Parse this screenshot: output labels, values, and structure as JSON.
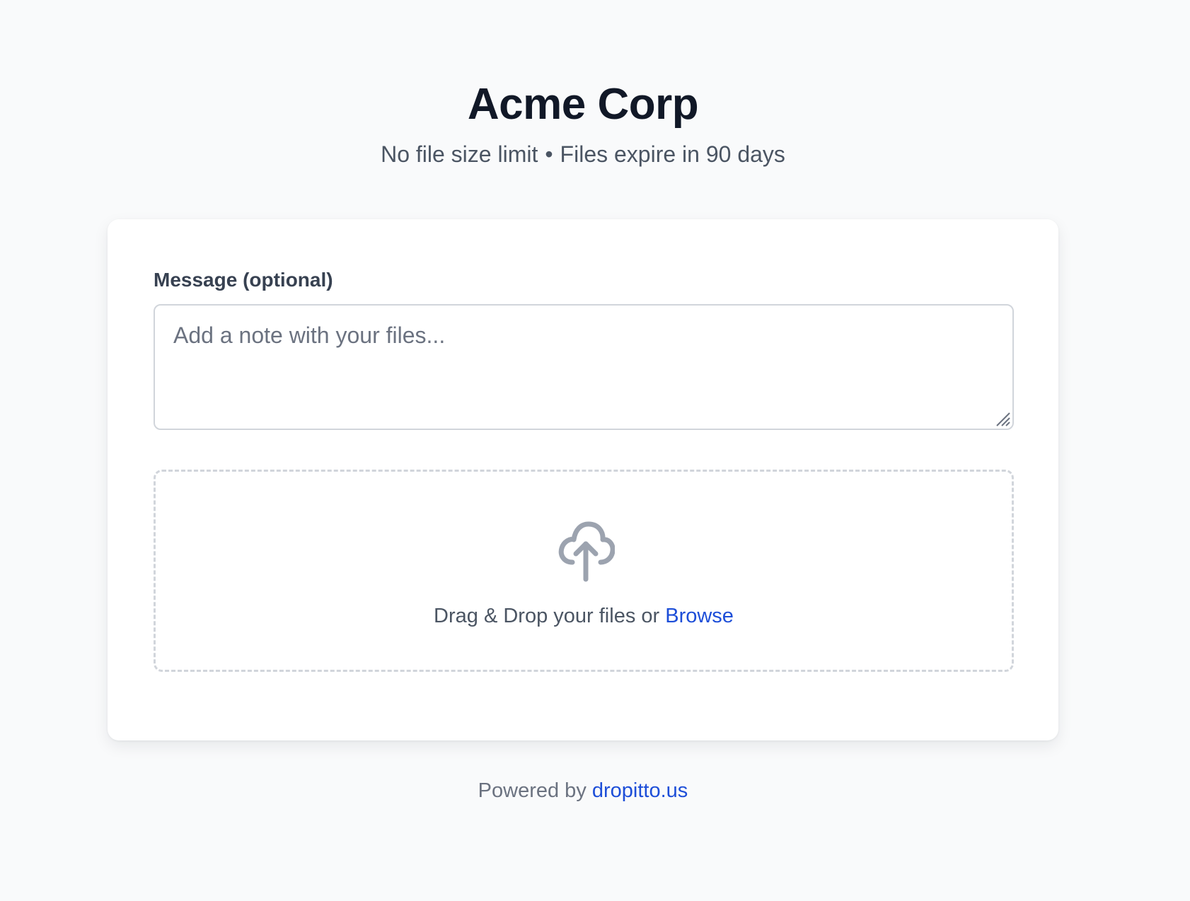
{
  "header": {
    "title": "Acme Corp",
    "size_limit": "No file size limit",
    "separator": "•",
    "expiry": "Files expire in 90 days"
  },
  "form": {
    "message_label": "Message (optional)",
    "message_placeholder": "Add a note with your files...",
    "message_value": ""
  },
  "dropzone": {
    "icon": "cloud-upload-icon",
    "prefix_text": "Drag & Drop your files or",
    "browse_label": "Browse"
  },
  "footer": {
    "prefix": "Powered by",
    "link_text": "dropitto.us"
  },
  "colors": {
    "background": "#f9fafb",
    "card": "#ffffff",
    "link": "#1d4ed8",
    "muted_text": "#4b5563",
    "icon": "#9ca3af"
  }
}
